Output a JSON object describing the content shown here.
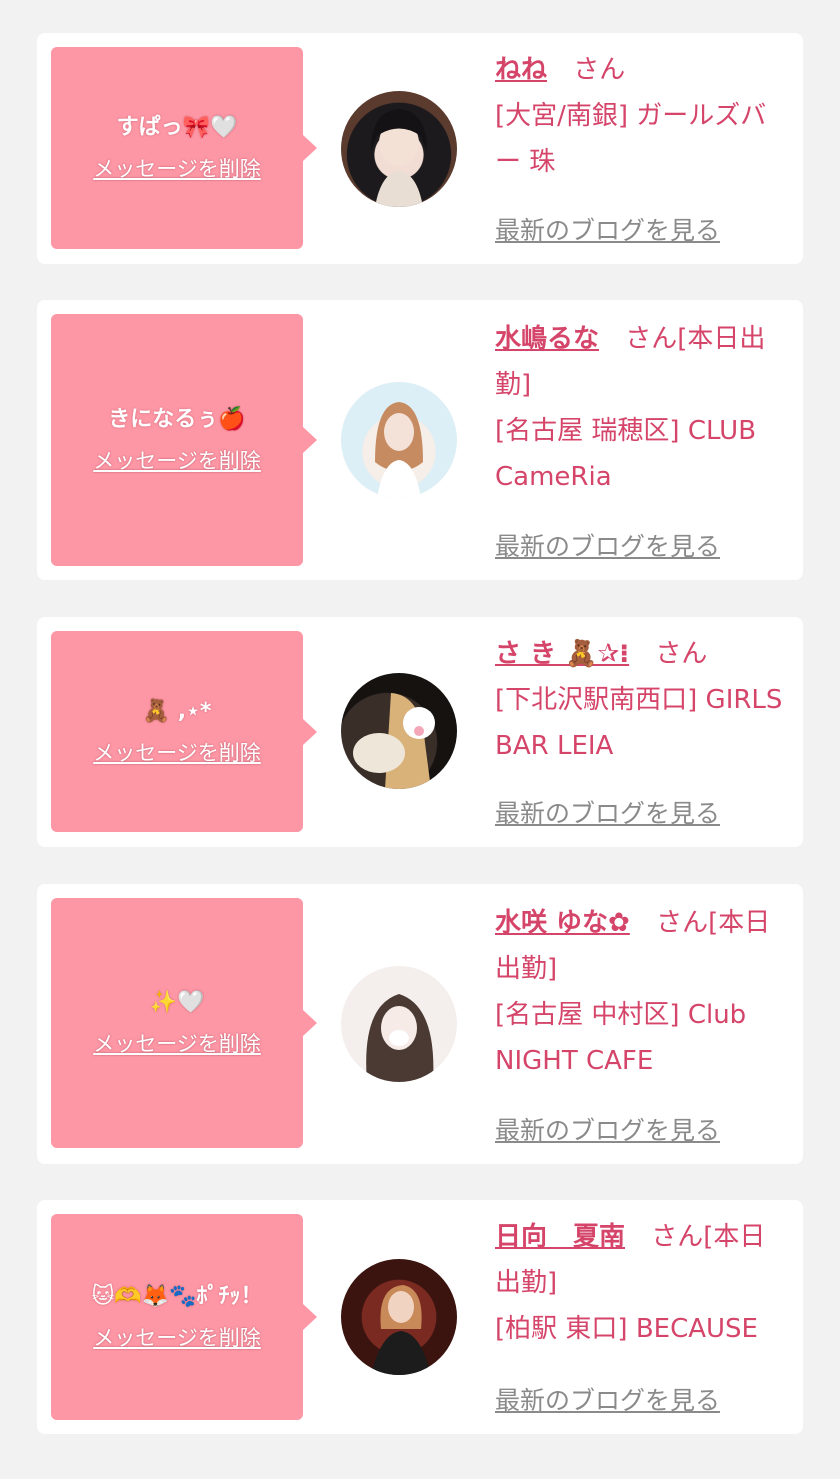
{
  "delete_label": "メッセージを削除",
  "blog_label": "最新のブログを見る",
  "colors": {
    "background": "#f2f2f2",
    "card": "#ffffff",
    "bubble": "#fe97a5",
    "accent_text": "#d5456a",
    "muted_text": "#8a8a8a"
  },
  "items": [
    {
      "message": "すぱっ🎀🤍",
      "name": "ねね",
      "honorific": "さん",
      "shop": "[大宮/南銀] ガールズバー 珠",
      "avatar_icon": "avatar-photo-1"
    },
    {
      "message": "きになるぅ🍎",
      "name": "水嶋るな",
      "honorific": "さん[本日出勤]",
      "shop": "[名古屋 瑞穂区] CLUB CameRia",
      "avatar_icon": "avatar-photo-2"
    },
    {
      "message": "🧸 ,⋆*",
      "name": "さ き 🧸✰⁝",
      "honorific": "さん",
      "shop": "[下北沢駅南西口] GIRLS BAR LEIA",
      "avatar_icon": "avatar-photo-3"
    },
    {
      "message": "✨🤍",
      "name": "水咲 ゆな✿",
      "honorific": "さん[本日出勤]",
      "shop": "[名古屋 中村区] Club NIGHT CAFE",
      "avatar_icon": "avatar-photo-4"
    },
    {
      "message": "🐱🫶🦊🐾ﾎﾟﾁｯ！",
      "name": "日向　夏南",
      "honorific": "さん[本日出勤]",
      "shop": "[柏駅 東口] BECAUSE",
      "avatar_icon": "avatar-photo-5"
    }
  ]
}
